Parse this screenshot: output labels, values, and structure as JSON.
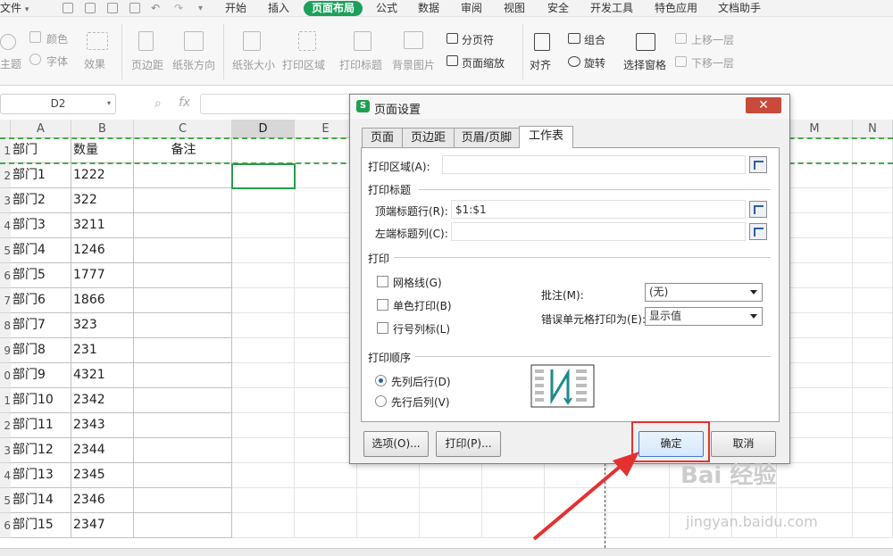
{
  "menubar": {
    "file_label": "文件",
    "tabs": [
      "开始",
      "插入",
      "页面布局",
      "公式",
      "数据",
      "审阅",
      "视图",
      "安全",
      "开发工具",
      "特色应用",
      "文档助手"
    ],
    "active_tab": "页面布局"
  },
  "ribbon": {
    "theme_label": "主题",
    "color_label": "颜色",
    "font_label": "字体",
    "effect_label": "效果",
    "margin_label": "页边距",
    "orientation_label": "纸张方向",
    "size_label": "纸张大小",
    "print_area_label": "打印区域",
    "print_titles_label": "打印标题",
    "background_label": "背景图片",
    "page_break_label": "分页符",
    "page_zoom_label": "页面缩放",
    "align_label": "对齐",
    "group_label": "组合",
    "rotate_label": "旋转",
    "selection_pane_label": "选择窗格",
    "bring_forward_label": "上移一层",
    "send_backward_label": "下移一层"
  },
  "formula_bar": {
    "name_box": "D2",
    "fx_label": "fx",
    "formula_value": ""
  },
  "sheet": {
    "columns": [
      "A",
      "B",
      "C",
      "D",
      "E",
      "M",
      "N"
    ],
    "selected_column": "D",
    "header": [
      "部门",
      "数量",
      "备注"
    ],
    "rows": [
      [
        "部门1",
        "1222"
      ],
      [
        "部门2",
        "322"
      ],
      [
        "部门3",
        "3211"
      ],
      [
        "部门4",
        "1246"
      ],
      [
        "部门5",
        "1777"
      ],
      [
        "部门6",
        "1866"
      ],
      [
        "部门7",
        "323"
      ],
      [
        "部门8",
        "231"
      ],
      [
        "部门9",
        "4321"
      ],
      [
        "部门10",
        "2342"
      ],
      [
        "部门11",
        "2343"
      ],
      [
        "部门12",
        "2344"
      ],
      [
        "部门13",
        "2345"
      ],
      [
        "部门14",
        "2346"
      ],
      [
        "部门15",
        "2347"
      ]
    ],
    "row_numbers": [
      "1",
      "2",
      "3",
      "4",
      "5",
      "6",
      "7",
      "8",
      "9",
      "0",
      "1",
      "2",
      "3",
      "4",
      "5",
      "6"
    ]
  },
  "dialog": {
    "title": "页面设置",
    "close": "✕",
    "tabs": [
      "页面",
      "页边距",
      "页眉/页脚",
      "工作表"
    ],
    "active_tab": "工作表",
    "print_area_label": "打印区域(A):",
    "print_area_value": "",
    "print_titles_section": "打印标题",
    "top_rows_label": "顶端标题行(R):",
    "top_rows_value": "$1:$1",
    "left_cols_label": "左端标题列(C):",
    "left_cols_value": "",
    "print_section": "打印",
    "gridlines_label": "网格线(G)",
    "gridlines_checked": false,
    "mono_label": "单色打印(B)",
    "mono_checked": false,
    "row_col_headers_label": "行号列标(L)",
    "row_col_headers_checked": false,
    "comments_label": "批注(M):",
    "comments_value": "(无)",
    "errors_label": "错误单元格打印为(E):",
    "errors_value": "显示值",
    "order_section": "打印顺序",
    "order_down_then_over": "先列后行(D)",
    "order_over_then_down": "先行后列(V)",
    "selected_order": "先列后行(D)",
    "options_button": "选项(O)...",
    "print_button": "打印(P)...",
    "ok_button": "确定",
    "cancel_button": "取消"
  },
  "watermark": {
    "brand": "Bai 经验",
    "url": "jingyan.baidu.com"
  },
  "colors": {
    "accent": "#1ca05c",
    "highlight_box": "#e53030",
    "arrow": "#e53030",
    "selection": "#2a9b4b"
  }
}
